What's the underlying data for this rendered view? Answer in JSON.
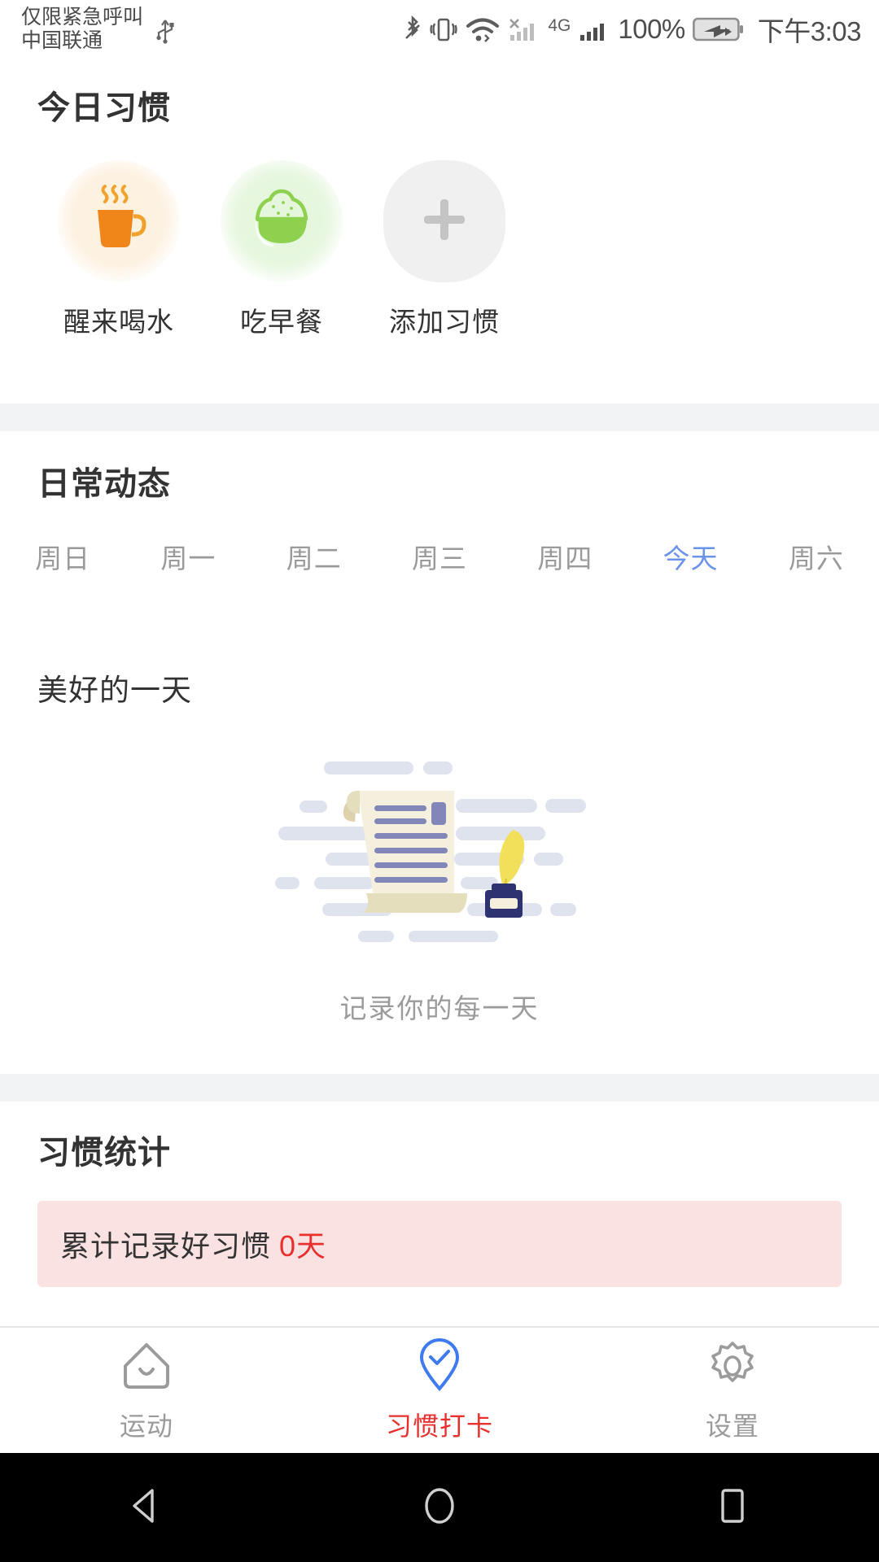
{
  "statusbar": {
    "carrier_line1": "仅限紧急呼叫",
    "carrier_line2": "中国联通",
    "usb_icon": "usb-icon",
    "bluetooth_icon": "bluetooth-icon",
    "vibrate_icon": "vibrate-icon",
    "wifi_icon": "wifi-icon",
    "sim1_icon": "sim1-signal-no-service-icon",
    "network_type": "4G",
    "sim2_icon": "sim2-signal-icon",
    "battery_percent": "100%",
    "battery_icon": "battery-charging-icon",
    "time": "下午3:03"
  },
  "habits_section": {
    "title": "今日习惯",
    "items": [
      {
        "label": "醒来喝水",
        "icon": "coffee-cup-icon",
        "color": "#f08519",
        "blob": "#fdf2e2"
      },
      {
        "label": "吃早餐",
        "icon": "rice-bowl-icon",
        "color": "#7dc943",
        "blob": "#e7f7e0"
      },
      {
        "label": "添加习惯",
        "icon": "plus-icon",
        "color": "#c4c4c4",
        "blob": "#f0f0f0"
      }
    ]
  },
  "daily_section": {
    "title": "日常动态",
    "weekdays": [
      {
        "label": "周日",
        "active": false
      },
      {
        "label": "周一",
        "active": false
      },
      {
        "label": "周二",
        "active": false
      },
      {
        "label": "周三",
        "active": false
      },
      {
        "label": "周四",
        "active": false
      },
      {
        "label": "今天",
        "active": true
      },
      {
        "label": "周六",
        "active": false
      }
    ],
    "active_color": "#6a93ea",
    "day_title": "美好的一天",
    "empty_illustration": "scroll-quill-inkwell-illustration",
    "empty_caption": "记录你的每一天"
  },
  "stats_section": {
    "title": "习惯统计",
    "banner_text": "累计记录好习惯",
    "banner_value": "0天",
    "banner_bg": "#fbe2e2",
    "banner_value_color": "#e8312f"
  },
  "bottom_nav": {
    "items": [
      {
        "label": "运动",
        "icon": "home-icon",
        "active": false
      },
      {
        "label": "习惯打卡",
        "icon": "pin-check-icon",
        "active": true
      },
      {
        "label": "设置",
        "icon": "gear-icon",
        "active": false
      }
    ],
    "active_color": "#e8312f",
    "inactive_color": "#9b9b9b",
    "active_icon_color": "#3f7bf0"
  },
  "android_nav": {
    "back": "back-triangle-icon",
    "home": "home-circle-icon",
    "recents": "recents-square-icon"
  }
}
